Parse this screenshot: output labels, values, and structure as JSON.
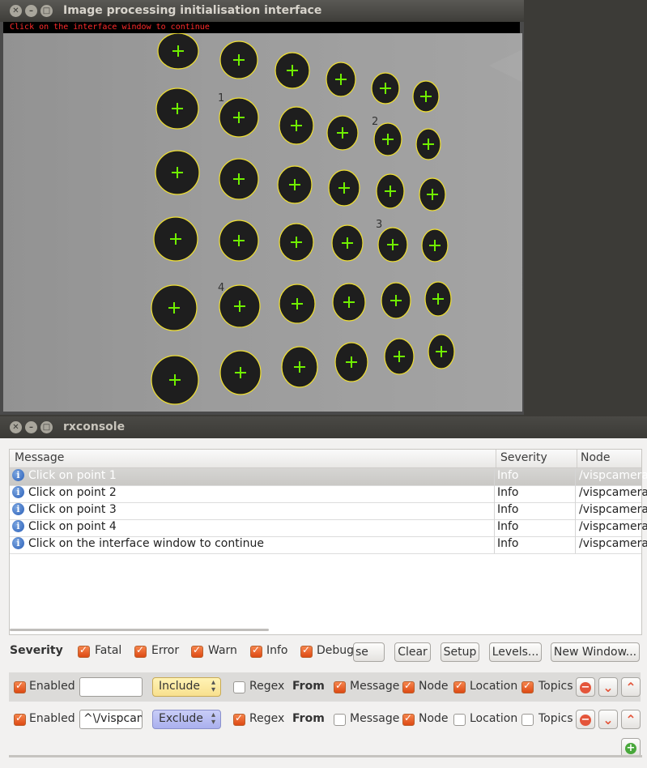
{
  "image_window": {
    "title": "Image processing initialisation interface",
    "status_text": "Click on the interface window to continue",
    "page_marks": [
      "1",
      "2",
      "3",
      "4"
    ]
  },
  "console_window": {
    "title": "rxconsole",
    "columns": [
      "Message",
      "Severity",
      "Node"
    ],
    "rows": [
      {
        "message": "Click on point 1",
        "severity": "Info",
        "node": "/vispcamera",
        "selected": true
      },
      {
        "message": "Click on point 2",
        "severity": "Info",
        "node": "/vispcamera",
        "selected": false
      },
      {
        "message": "Click on point 3",
        "severity": "Info",
        "node": "/vispcamera",
        "selected": false
      },
      {
        "message": "Click on point 4",
        "severity": "Info",
        "node": "/vispcamera",
        "selected": false
      },
      {
        "message": "Click on the interface window to continue",
        "severity": "Info",
        "node": "/vispcamera",
        "selected": false
      }
    ],
    "severity": {
      "label": "Severity",
      "levels": [
        {
          "label": "Fatal",
          "checked": true
        },
        {
          "label": "Error",
          "checked": true
        },
        {
          "label": "Warn",
          "checked": true
        },
        {
          "label": "Info",
          "checked": true
        },
        {
          "label": "Debug",
          "checked": true
        }
      ]
    },
    "toolbar": {
      "pause_partial": "se",
      "clear": "Clear",
      "setup": "Setup",
      "levels": "Levels...",
      "new_window": "New Window..."
    },
    "filters": [
      {
        "enabled_label": "Enabled",
        "enabled": true,
        "text": "",
        "mode": "Include",
        "regex_label": "Regex",
        "regex": false,
        "from_label": "From",
        "message_label": "Message",
        "message": true,
        "node_label": "Node",
        "node": true,
        "location_label": "Location",
        "location": true,
        "topics_label": "Topics",
        "topics": true
      },
      {
        "enabled_label": "Enabled",
        "enabled": true,
        "text": "^\\/vispcam",
        "mode": "Exclude",
        "regex_label": "Regex",
        "regex": true,
        "from_label": "From",
        "message_label": "Message",
        "message": false,
        "node_label": "Node",
        "node": true,
        "location_label": "Location",
        "location": false,
        "topics_label": "Topics",
        "topics": false
      }
    ]
  },
  "colors": {
    "title_bar": "#3c3b37",
    "blob_outline": "#f0e030",
    "cross": "#70f000",
    "status_text": "#ff2a2a",
    "checkbox": "#e8581e",
    "include_combo": "#f8e08e",
    "exclude_combo": "#aab0ee"
  }
}
